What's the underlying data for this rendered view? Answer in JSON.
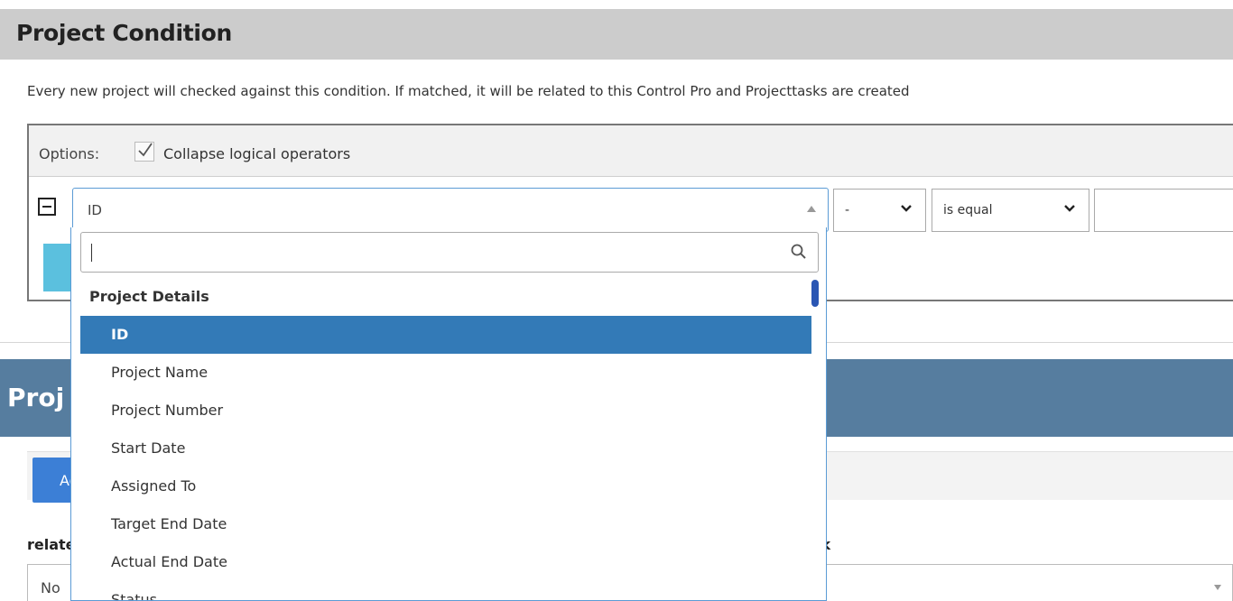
{
  "section": {
    "title": "Project Condition"
  },
  "description": "Every new project will checked against this condition. If matched, it will be related to this Control Pro and Projecttasks are created",
  "options": {
    "label": "Options:",
    "collapse_label": "Collapse logical operators",
    "collapse_checked": true
  },
  "condition": {
    "field_value": "ID",
    "operator_value": "-",
    "comparison_value": "is equal",
    "input_value": ""
  },
  "dropdown": {
    "search_value": "",
    "group_label": "Project Details",
    "items": [
      {
        "label": "ID",
        "selected": true
      },
      {
        "label": "Project Name"
      },
      {
        "label": "Project Number"
      },
      {
        "label": "Start Date"
      },
      {
        "label": "Assigned To"
      },
      {
        "label": "Target End Date"
      },
      {
        "label": "Actual End Date"
      },
      {
        "label": "Status"
      }
    ]
  },
  "lower": {
    "header_title": "Proj",
    "action_button": "Ad",
    "related_label": "relate",
    "task_label": "sk",
    "bottom_select_value": "No"
  },
  "colors": {
    "header_gray": "#cccccc",
    "selected_blue": "#337ab7",
    "section_blue": "#567d9f",
    "button_blue": "#3c7fd6",
    "cyan": "#5bc0de"
  }
}
